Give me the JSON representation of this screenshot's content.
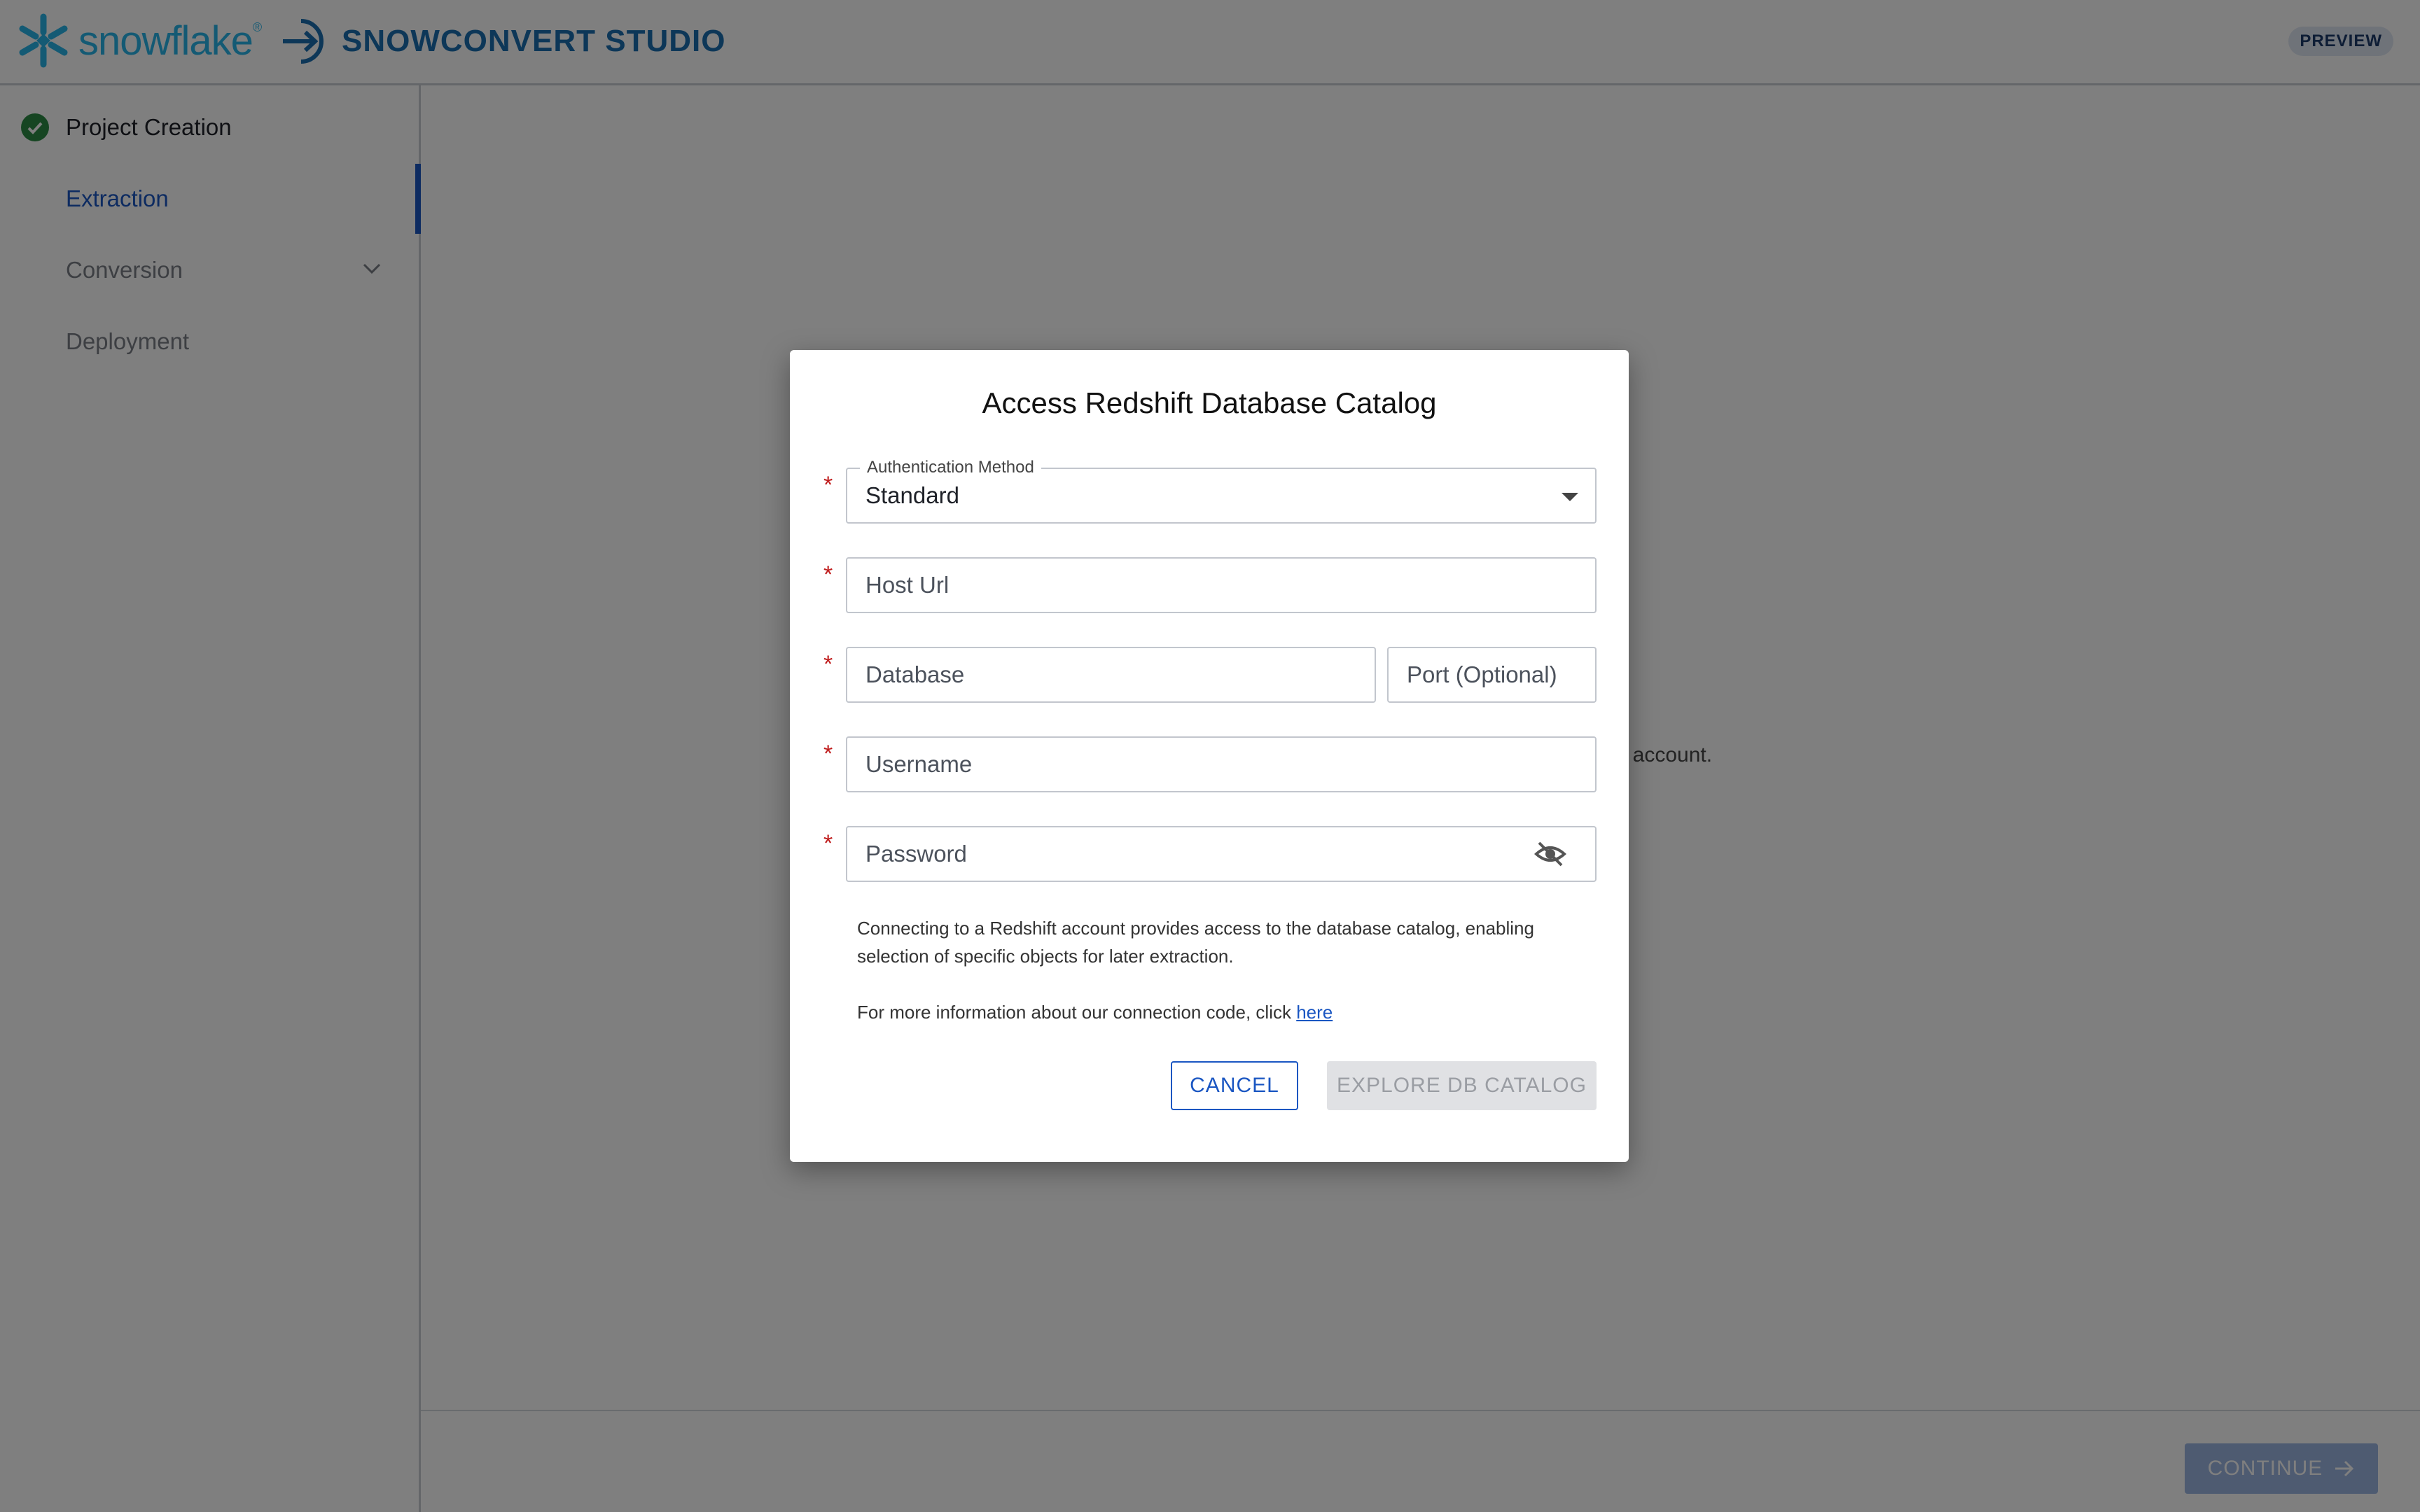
{
  "header": {
    "brand_name": "snowflake",
    "brand_mark": "®",
    "app_name": "SNOWCONVERT STUDIO",
    "preview_badge": "PREVIEW"
  },
  "sidebar": {
    "steps": [
      {
        "label": "Project Creation",
        "state": "completed",
        "icon": "check-circle-icon"
      },
      {
        "label": "Extraction",
        "state": "active"
      },
      {
        "label": "Conversion",
        "state": "pending",
        "icon": "chevron-down-icon"
      },
      {
        "label": "Deployment",
        "state": "pending"
      }
    ]
  },
  "background": {
    "partial_text": "ift account.",
    "continue_label": "CONTINUE"
  },
  "dialog": {
    "title": "Access Redshift Database Catalog",
    "auth": {
      "label": "Authentication Method",
      "value": "Standard"
    },
    "host_placeholder": "Host Url",
    "database_placeholder": "Database",
    "port_placeholder": "Port (Optional)",
    "username_placeholder": "Username",
    "password_placeholder": "Password",
    "required_marker": "*",
    "info_text": "Connecting to a Redshift account provides access to the database catalog, enabling selection of specific objects for later extraction.",
    "more_info_prefix": "For more information about our connection code, click ",
    "more_info_link": "here",
    "cancel_label": "CANCEL",
    "explore_label": "EXPLORE DB CATALOG"
  },
  "colors": {
    "accent": "#1a56c2",
    "brand": "#29b5e8",
    "studio": "#1a6fb0",
    "success": "#2c8a45",
    "required": "#c01e1e"
  }
}
